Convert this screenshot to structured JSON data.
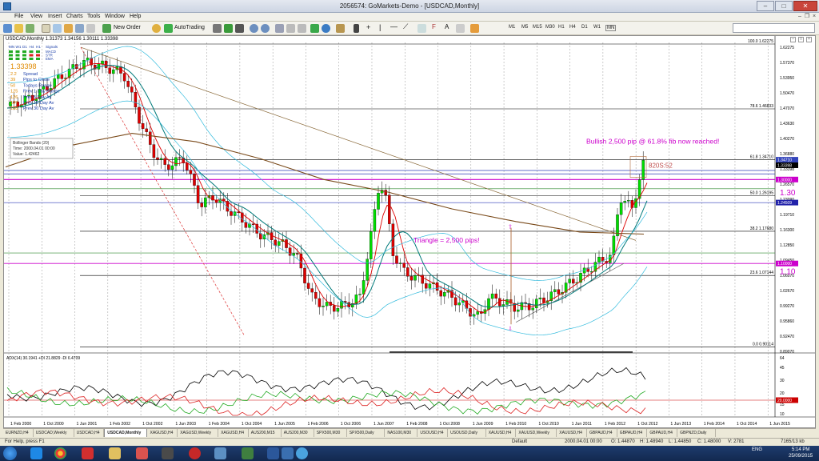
{
  "window": {
    "title": "2056574: GoMarkets-Demo - [USDCAD,Monthly]",
    "min": "‒",
    "max": "□",
    "close": "✕"
  },
  "menu": [
    "File",
    "View",
    "Insert",
    "Charts",
    "Tools",
    "Window",
    "Help"
  ],
  "toolbar": {
    "new_order": "New Order",
    "autotrading": "AutoTrading",
    "timeframes": [
      "M1",
      "M5",
      "M15",
      "M30",
      "H1",
      "H4",
      "D1",
      "W1",
      "MN"
    ]
  },
  "chart": {
    "header": "USDCAD,Monthly  1.31373 1.34156 1.30111 1.33398",
    "panel": {
      "labels": [
        "MN",
        "W1",
        "D1",
        "H4",
        "H1"
      ],
      "signals": "Signals",
      "ind_legend": [
        "MACD",
        "STR",
        "EMA"
      ],
      "price": "1.33398",
      "rows": [
        {
          "v": "2.2",
          "l": "Spread"
        },
        {
          "v": "39",
          "l": "Pips to Close"
        },
        {
          "v": "50",
          "l": "Todays Range"
        },
        {
          "v": "125",
          "l": "Prev 1 Day Range"
        },
        {
          "v": "126",
          "l": "Prev 5 Day Av"
        },
        {
          "v": "127",
          "l": "Prev 10 Day Av"
        },
        {
          "v": "168",
          "l": "Prev 30 Day Av"
        }
      ]
    },
    "tooltip": [
      "Bollinger Bands (20)",
      "Time: 2000.04.01 00:00",
      "Value: 1.42462"
    ],
    "annotations": {
      "bullish": "Bullish 2,500 pip @ 61.8% fib now reached!",
      "triangle": "Triangle = 2,500 pips!",
      "level_130": "1.30",
      "level_110": "1.10",
      "counter": "820S:52"
    },
    "price_axis": [
      "1.62275",
      "1.57370",
      "1.53950",
      "1.50470",
      "1.47070",
      "1.43630",
      "1.40270",
      "1.36880",
      "1.33398",
      "1.26570",
      "1.23090",
      "1.19710",
      "1.16300",
      "1.12850",
      "1.09450",
      "1.06070",
      "1.02670",
      "0.99270",
      "0.95860",
      "0.92470",
      "0.89070"
    ],
    "price_badges": [
      {
        "t": "1.34710",
        "c": "#3344bb"
      },
      {
        "t": "1.33398",
        "c": "#000000"
      },
      {
        "t": "1.30000",
        "c": "#cc00cc"
      },
      {
        "t": "1.24509",
        "c": "#2222aa"
      },
      {
        "t": "1.10000",
        "c": "#cc00cc"
      }
    ],
    "fib_labels": [
      {
        "t": "100.0  1.62275",
        "v": 1.62275
      },
      {
        "t": "78.6  1.46833",
        "v": 1.46833
      },
      {
        "t": "61.8  1.34710",
        "v": 1.3471
      },
      {
        "t": "50.0  1.26195",
        "v": 1.26195
      },
      {
        "t": "38.2  1.17680",
        "v": 1.1768
      },
      {
        "t": "23.6  1.07144",
        "v": 1.07144
      },
      {
        "t": "0.0  0.90114",
        "v": 0.90114
      }
    ],
    "adx": {
      "header": "ADX(14) 30.1941 +DI 21.8829 -DI 6.4709",
      "axis": [
        "64",
        "45",
        "30",
        "20",
        "15",
        "10"
      ],
      "level": "20.0000"
    },
    "time_axis": [
      "1 Feb 2000",
      "1 Oct 2000",
      "1 Jun 2001",
      "1 Feb 2002",
      "1 Oct 2002",
      "1 Jun 2003",
      "1 Feb 2004",
      "1 Oct 2004",
      "1 Jun 2005",
      "1 Feb 2006",
      "1 Oct 2006",
      "1 Jun 2007",
      "1 Feb 2008",
      "1 Oct 2008",
      "1 Jun 2009",
      "1 Feb 2010",
      "1 Oct 2010",
      "1 Jun 2011",
      "1 Feb 2012",
      "1 Oct 2012",
      "1 Jun 2013",
      "1 Feb 2014",
      "1 Oct 2014",
      "1 Jun 2015"
    ]
  },
  "tabs": [
    "EURNZD,H4",
    "USDCAD,Weekly",
    "USDCAD,H4",
    "USDCAD,Monthly",
    "XAGUSD,H4",
    "XAGUSD,Weekly",
    "XAGUSD,H4",
    "AUS200,M15",
    "AUS200,M30",
    "SPX500,M30",
    "SPX500,Daily",
    "NAS100,M30",
    "USOUSD,H4",
    "USOUSD,Daily",
    "XAUUSD,H4",
    "XAUUSD,Weekly",
    "XAUUSD,H4",
    "GBPAUD,H4",
    "GBPAUD,H4",
    "GBPAUD,H4",
    "GBPNZD,Daily"
  ],
  "active_tab": 3,
  "status": {
    "help": "For Help, press F1",
    "profile": "Default",
    "time": "2000.04.01 00:00",
    "o": "O: 1.44870",
    "h": "H: 1.48940",
    "l": "L: 1.44850",
    "c": "C: 1.48000",
    "v": "V: 2781",
    "kb": "7165/13 kb"
  },
  "tray": {
    "lang": "ENG",
    "time": "5:14 PM",
    "date": "25/09/2015"
  },
  "colors": {
    "bull": "#00dd00",
    "bear": "#dd0000",
    "fib": "#000000",
    "magenta": "#cc00cc",
    "ma_teal": "#007a7a",
    "ma_red": "#dd0000",
    "ma_brown": "#7a4a1a",
    "bb": "#33bbdd"
  }
}
